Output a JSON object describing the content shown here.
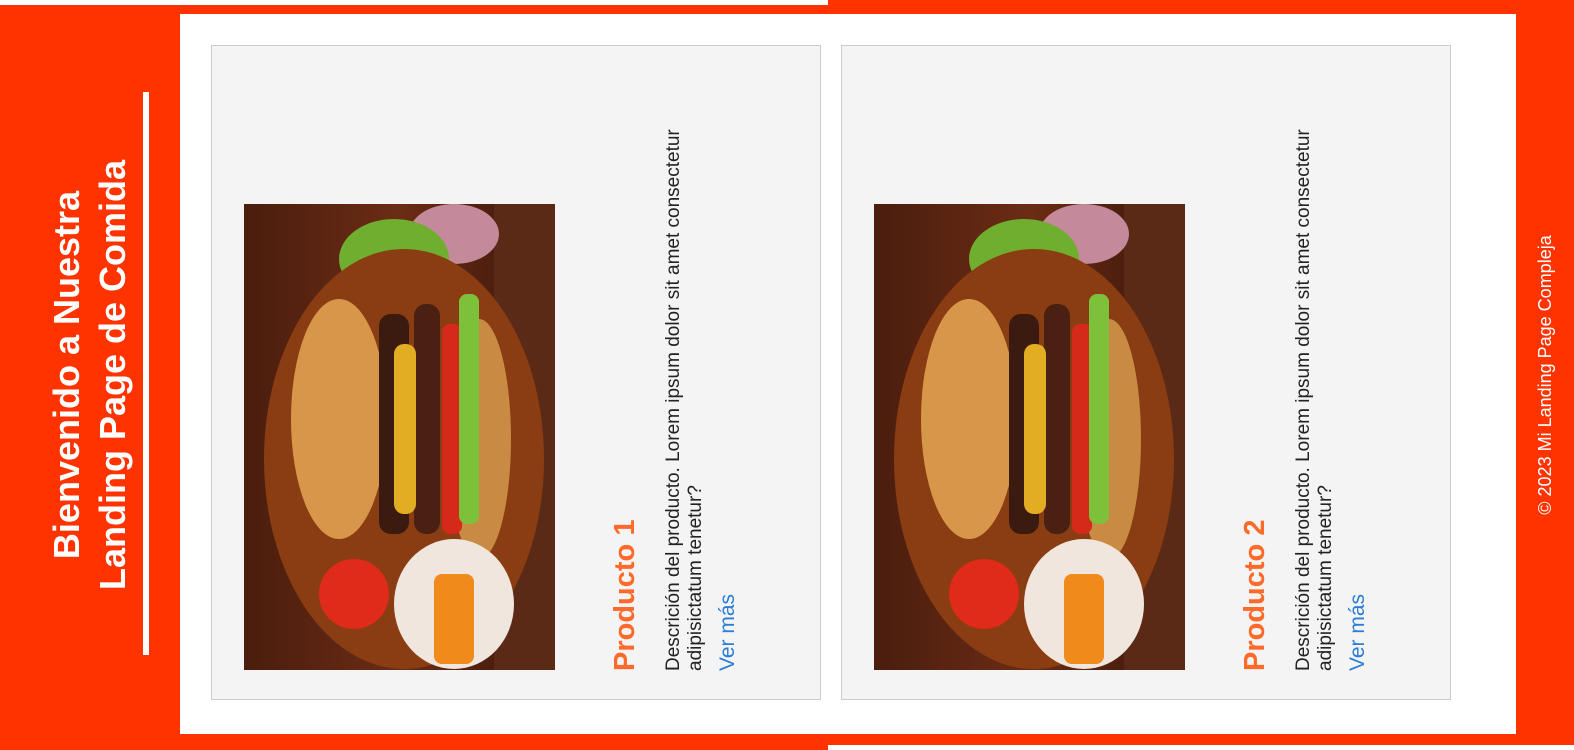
{
  "header": {
    "title": "Bienvenido a Nuestra\nLanding Page de Comida"
  },
  "products": [
    {
      "title": "Producto 1",
      "description": "Descrición del producto. Lorem ipsum dolor sit amet consectetur adipisictatum tenetur?",
      "link_label": "Ver más",
      "image_alt": "burger-photo"
    },
    {
      "title": "Producto 2",
      "description": "Descrición del producto. Lorem ipsum dolor sit amet consectetur adipisictatum tenetur?",
      "link_label": "Ver más",
      "image_alt": "burger-photo"
    }
  ],
  "footer": {
    "copyright": "© 2023 Mi Landing Page Compleja"
  },
  "colors": {
    "brand": "#ff3300",
    "accent_title": "#ff6a2a",
    "link": "#2a7dd6",
    "card_bg": "#f4f4f4"
  }
}
